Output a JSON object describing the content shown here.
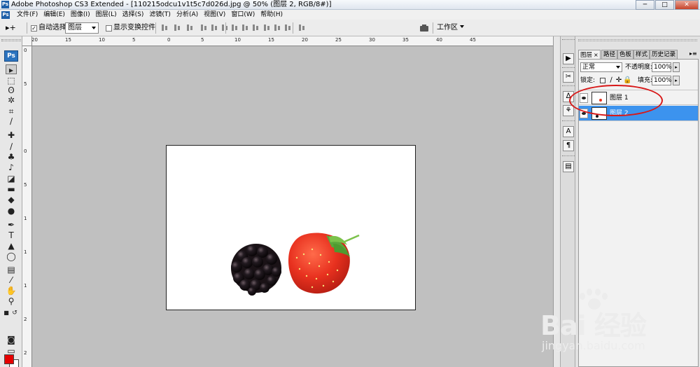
{
  "titlebar": {
    "title": "Adobe Photoshop CS3 Extended - [110215odcu1v1t5c7d026d.jpg @ 50% (图层 2, RGB/8#)]",
    "app_icon_label": "Ps",
    "minimize_label": "─",
    "maximize_label": "□",
    "close_label": "✕"
  },
  "menubar": {
    "logo_label": "Ps",
    "items": [
      "文件(F)",
      "编辑(E)",
      "图像(I)",
      "图层(L)",
      "选择(S)",
      "滤镜(T)",
      "分析(A)",
      "视图(V)",
      "窗口(W)",
      "帮助(H)"
    ]
  },
  "options": {
    "tool_glyph": "▸+",
    "auto_select_label": "自动选择:",
    "auto_select_checked": "✓",
    "auto_select_value": "图层",
    "transform_controls_label": "显示变换控件",
    "workspace_label": "工作区"
  },
  "toolbox": {
    "logo": "Ps",
    "fg_color": "#e60000",
    "bg_color": "#ffffff",
    "tools": [
      {
        "name": "move-tool",
        "glyph": "▸"
      },
      {
        "name": "marquee-tool",
        "glyph": "⬚"
      },
      {
        "name": "lasso-tool",
        "glyph": "ʘ"
      },
      {
        "name": "magic-wand-tool",
        "glyph": "✲"
      },
      {
        "name": "crop-tool",
        "glyph": "⌗"
      },
      {
        "name": "eyedropper-tool",
        "glyph": "∕"
      },
      {
        "name": "healing-brush-tool",
        "glyph": "✚"
      },
      {
        "name": "brush-tool",
        "glyph": "∕"
      },
      {
        "name": "clone-stamp-tool",
        "glyph": "♣"
      },
      {
        "name": "history-brush-tool",
        "glyph": "♪"
      },
      {
        "name": "eraser-tool",
        "glyph": "◪"
      },
      {
        "name": "gradient-tool",
        "glyph": "▬"
      },
      {
        "name": "blur-tool",
        "glyph": "◆"
      },
      {
        "name": "dodge-tool",
        "glyph": "●"
      },
      {
        "name": "pen-tool",
        "glyph": "✒"
      },
      {
        "name": "type-tool",
        "glyph": "T"
      },
      {
        "name": "path-selection-tool",
        "glyph": "▲"
      },
      {
        "name": "shape-tool",
        "glyph": "◯"
      },
      {
        "name": "notes-tool",
        "glyph": "▤"
      },
      {
        "name": "eyedropper2-tool",
        "glyph": "⁄"
      },
      {
        "name": "hand-tool",
        "glyph": "✋"
      },
      {
        "name": "zoom-tool",
        "glyph": "⚲"
      },
      {
        "name": "quick-mask-tool",
        "glyph": "◙"
      },
      {
        "name": "screen-mode-tool",
        "glyph": "▭"
      }
    ]
  },
  "rulers": {
    "top_labels": [
      "20",
      "15",
      "10",
      "5",
      "0",
      "5",
      "10",
      "15",
      "20",
      "25",
      "30",
      "35",
      "40",
      "45"
    ],
    "left_labels": [
      "0",
      "5",
      "0",
      "5",
      "1",
      "1",
      "1",
      "2",
      "2"
    ]
  },
  "dock": {
    "buttons": [
      {
        "name": "navigator-icon",
        "glyph": "▶"
      },
      {
        "name": "tools-preset-icon",
        "glyph": "✂"
      },
      {
        "name": "brushes-icon",
        "glyph": "ᐃ"
      },
      {
        "name": "clone-source-icon",
        "glyph": "⚘"
      },
      {
        "name": "character-icon",
        "glyph": "A"
      },
      {
        "name": "paragraph-icon",
        "glyph": "¶"
      },
      {
        "name": "layer-comps-icon",
        "glyph": "▤"
      }
    ]
  },
  "layers_panel": {
    "tabs": [
      {
        "label": "图层",
        "close": "×"
      },
      {
        "label": "路径"
      },
      {
        "label": "色板"
      },
      {
        "label": "样式"
      },
      {
        "label": "历史记录"
      }
    ],
    "menu_glyph": "▸≡",
    "blend_mode": "正常",
    "opacity_label": "不透明度:",
    "opacity_value": "100%",
    "lock_label": "锁定:",
    "fill_label": "填充:",
    "fill_value": "100%",
    "spin_glyph": "▸",
    "layers": [
      {
        "name": "图层 1",
        "selected": false
      },
      {
        "name": "图层 2",
        "selected": true
      }
    ]
  },
  "document": {
    "background_color": "#ffffff"
  },
  "watermark": {
    "brand": "Bai 经验",
    "url": "jingyan.baidu.com"
  },
  "annotation": {
    "color": "#d81818"
  }
}
